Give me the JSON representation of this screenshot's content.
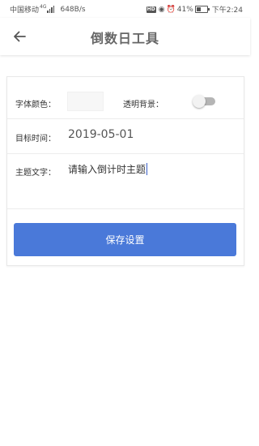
{
  "status_bar": {
    "carrier": "中国移动",
    "network_type": "4G",
    "speed": "648B/s",
    "battery": "41%",
    "battery_level": 0.41,
    "time": "下午2:24"
  },
  "header": {
    "title": "倒数日工具",
    "back_icon": "arrow-left-icon"
  },
  "form": {
    "font_color_label": "字体颜色：",
    "font_color_value": "#f7f7f7",
    "transparent_bg_label": "透明背景：",
    "transparent_bg_on": false,
    "target_time_label": "目标时间：",
    "target_time_value": "2019-05-01",
    "theme_text_label": "主题文字：",
    "theme_text_placeholder": "请输入倒计时主题"
  },
  "actions": {
    "save_label": "保存设置"
  },
  "colors": {
    "accent": "#4a79d9",
    "title_text": "#666666"
  }
}
